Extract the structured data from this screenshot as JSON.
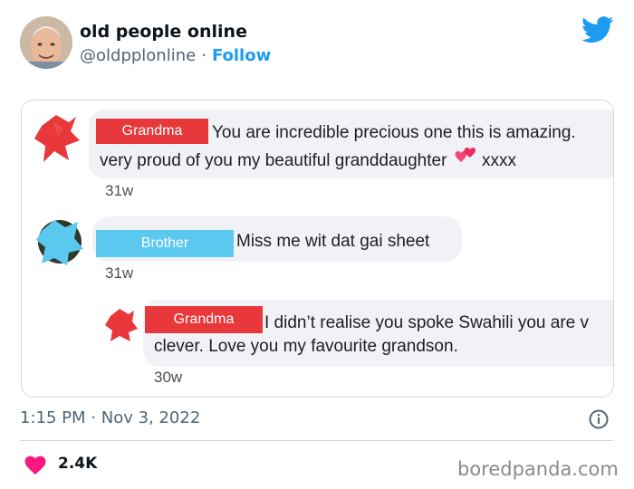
{
  "author": {
    "name": "old people online",
    "handle": "@oldpplonline",
    "separator": "·",
    "follow_label": "Follow"
  },
  "comments": [
    {
      "name_tag": "Grandma",
      "line1": "You are incredible precious one this is amazing.",
      "line2_before": "very proud of you my beautiful granddaughter",
      "line2_after": "xxxx",
      "time": "31w"
    },
    {
      "name_tag": "Brother",
      "line1": "Miss me wit dat gai sheet",
      "time": "31w"
    },
    {
      "name_tag": "Grandma",
      "line1": "I didn’t realise you spoke Swahili you are v",
      "line2": "clever. Love you my favourite grandson.",
      "time": "30w"
    }
  ],
  "meta": {
    "time": "1:15 PM",
    "separator": "·",
    "date": "Nov 3, 2022"
  },
  "likes": {
    "count": "2.4K"
  },
  "watermark": "boredpanda.com",
  "colors": {
    "twitter_blue": "#1d9bf0",
    "grandma_tag": "#e8383b",
    "brother_tag": "#5bc8ef",
    "like_pink": "#f91880"
  }
}
